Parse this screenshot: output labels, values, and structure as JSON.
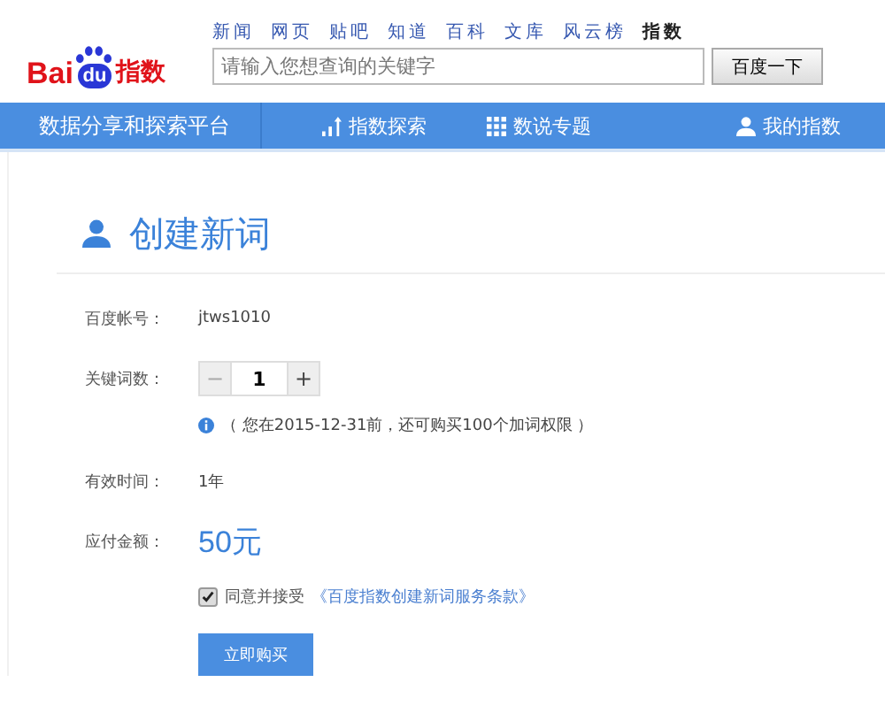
{
  "logo": {
    "part1": "Bai",
    "part2": "du",
    "part3": "指数"
  },
  "top_links": [
    {
      "label": "新闻",
      "selected": false
    },
    {
      "label": "网页",
      "selected": false
    },
    {
      "label": "贴吧",
      "selected": false
    },
    {
      "label": "知道",
      "selected": false
    },
    {
      "label": "百科",
      "selected": false
    },
    {
      "label": "文库",
      "selected": false
    },
    {
      "label": "风云榜",
      "selected": false
    },
    {
      "label": "指数",
      "selected": true
    }
  ],
  "search": {
    "placeholder": "请输入您想查询的关键字",
    "button": "百度一下"
  },
  "navbar": {
    "tagline": "数据分享和探索平台",
    "items": [
      {
        "label": "指数探索",
        "kind": "chart"
      },
      {
        "label": "数说专题",
        "kind": "grid"
      },
      {
        "label": "我的指数",
        "kind": "user"
      }
    ]
  },
  "page_title": "创建新词",
  "form": {
    "account_label": "百度帐号：",
    "account": "jtws1010",
    "keywords_label": "关键词数：",
    "stepper": {
      "minus": "−",
      "value": "1",
      "plus": "+"
    },
    "notice": "（ 您在2015-12-31前，还可购买100个加词权限 ）",
    "period_label": "有效时间：",
    "period": "1年",
    "amount_label": "应付金额：",
    "amount": "50元",
    "agree": {
      "checked": true,
      "text": "同意并接受",
      "link": "《百度指数创建新词服务条款》"
    },
    "submit": "立即购买"
  }
}
